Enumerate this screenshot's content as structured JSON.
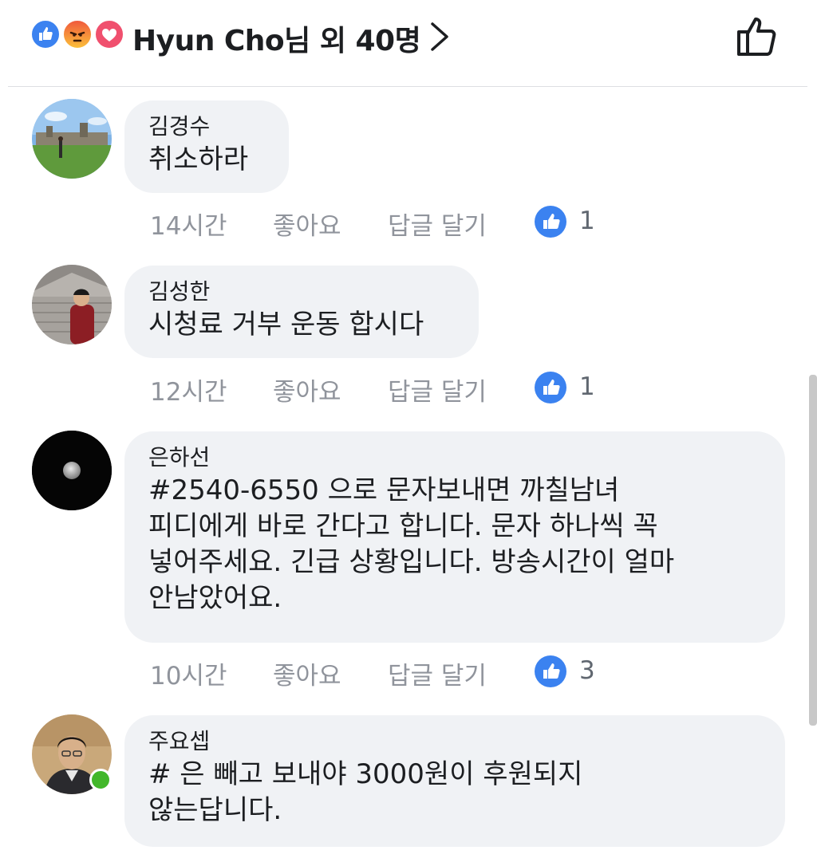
{
  "header": {
    "reactions": [
      "like-icon",
      "angry-icon",
      "love-icon"
    ],
    "summary": "Hyun Cho님 외 40명"
  },
  "comments": [
    {
      "name": "김경수",
      "text": "취소하라",
      "time": "14시간",
      "like": "좋아요",
      "reply": "답글 달기",
      "likes": "1"
    },
    {
      "name": "김성한",
      "text": "시청료 거부 운동 합시다",
      "time": "12시간",
      "like": "좋아요",
      "reply": "답글 달기",
      "likes": "1"
    },
    {
      "name": "은하선",
      "text": "#2540-6550 으로 문자보내면 까칠남녀\n피디에게 바로 간다고 합니다. 문자 하나씩 꼭\n넣어주세요. 긴급 상황입니다. 방송시간이 얼마\n안남았어요.",
      "time": "10시간",
      "like": "좋아요",
      "reply": "답글 달기",
      "likes": "3"
    },
    {
      "name": "주요셉",
      "text": "# 은 빼고 보내야 3000원이 후원되지\n않는답니다.",
      "online": true
    }
  ],
  "colors": {
    "facebook_blue": "#3b82f0",
    "bubble": "#f0f2f5",
    "meta_gray": "#90949c",
    "online_green": "#42b72a"
  }
}
